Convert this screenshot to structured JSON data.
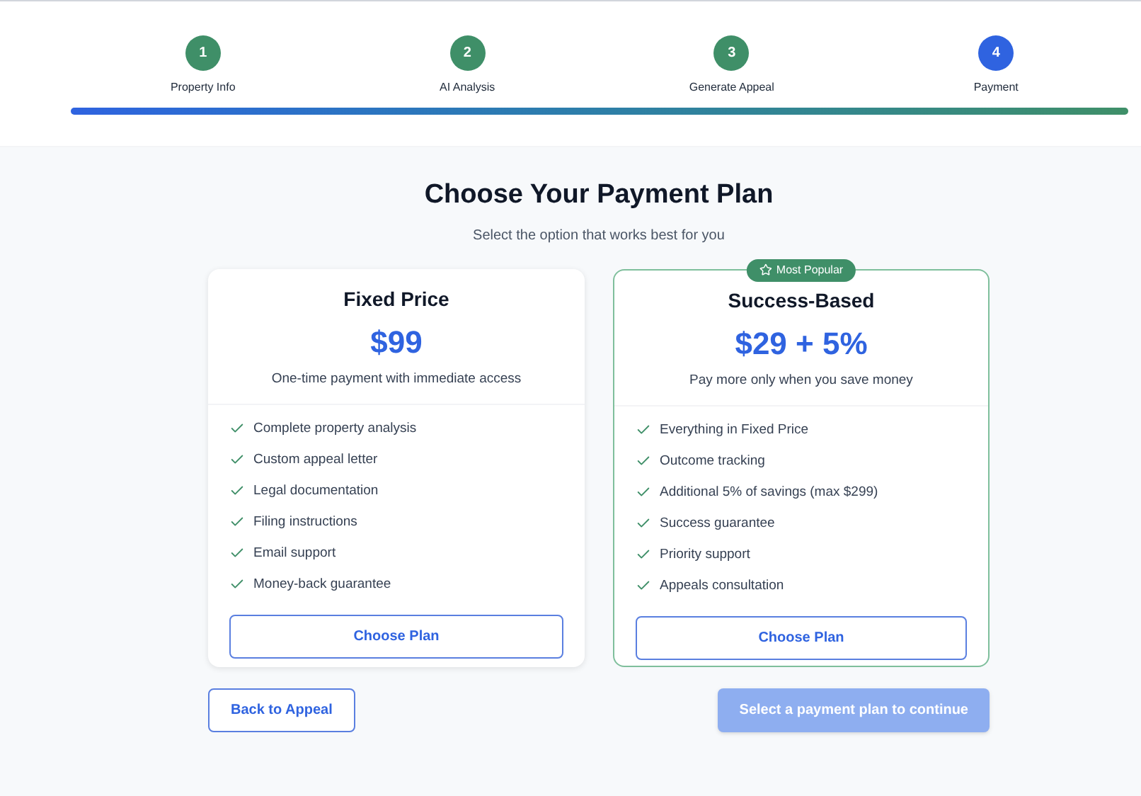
{
  "steps": [
    {
      "number": "1",
      "label": "Property Info",
      "selected": false
    },
    {
      "number": "2",
      "label": "AI Analysis",
      "selected": false
    },
    {
      "number": "3",
      "label": "Generate Appeal",
      "selected": false
    },
    {
      "number": "4",
      "label": "Payment",
      "selected": true
    }
  ],
  "progress": {
    "level": 1
  },
  "heading": "Choose Your Payment Plan",
  "subheading": "Select the option that works best for you",
  "plans": [
    {
      "name": "Fixed Price",
      "price": "$99",
      "description": "One-time payment with immediate access",
      "featured": false,
      "features": [
        "Complete property analysis",
        "Custom appeal letter",
        "Legal documentation",
        "Filing instructions",
        "Email support",
        "Money-back guarantee"
      ],
      "button": "Choose Plan"
    },
    {
      "name": "Success-Based",
      "price": "$29 + 5%",
      "description": "Pay more only when you save money",
      "featured": true,
      "badge": "Most Popular",
      "features": [
        "Everything in Fixed Price",
        "Outcome tracking",
        "Additional 5% of savings (max $299)",
        "Success guarantee",
        "Priority support",
        "Appeals consultation"
      ],
      "button": "Choose Plan"
    }
  ],
  "back_button": "Back to Appeal",
  "continue_button": {
    "label": "Select a payment plan to continue",
    "disabled": true
  }
}
